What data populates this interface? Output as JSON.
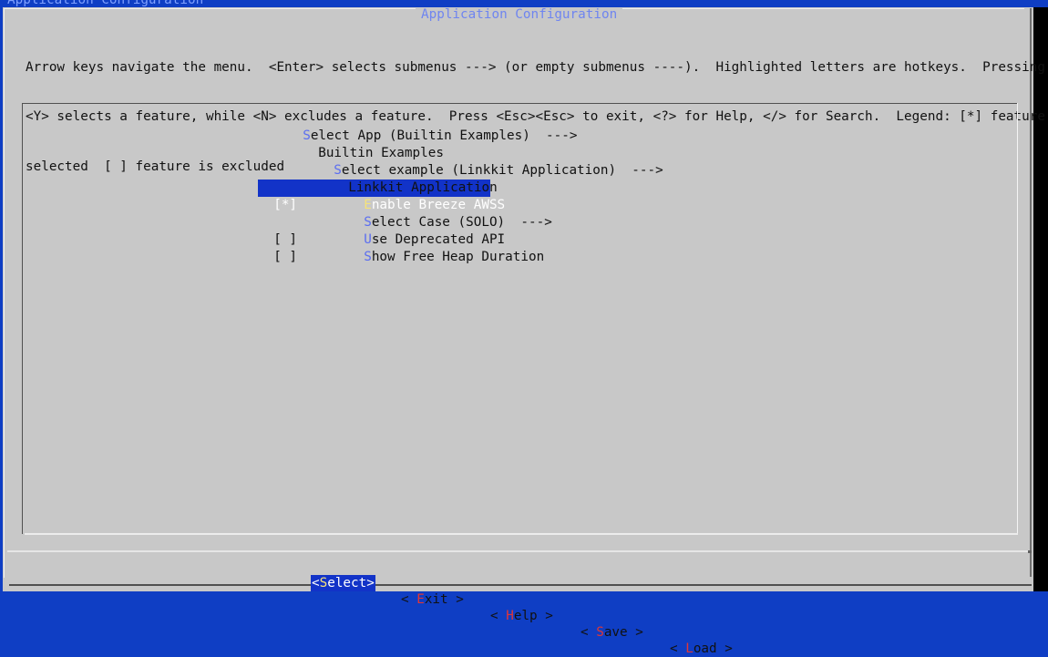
{
  "window": {
    "topbar_title": "Application Configuration"
  },
  "dialog": {
    "title": "Application Configuration",
    "help_lines": [
      "Arrow keys navigate the menu.  <Enter> selects submenus ---> (or empty submenus ----).  Highlighted letters are hotkeys.  Pressing",
      "<Y> selects a feature, while <N> excludes a feature.  Press <Esc><Esc> to exit, <?> for Help, </> for Search.  Legend: [*] feature is",
      "selected  [ ] feature is excluded"
    ]
  },
  "menu": {
    "items": [
      {
        "checkbox": "",
        "hotkey": "S",
        "rest": "elect App (Builtin Examples)  --->",
        "selected": false
      },
      {
        "checkbox": "",
        "hotkey": "",
        "rest": "Builtin Examples",
        "selected": false
      },
      {
        "checkbox": "",
        "hotkey": "S",
        "rest": "elect example (Linkkit Application)  --->",
        "selected": false
      },
      {
        "checkbox": "",
        "hotkey": "",
        "rest": "Linkkit Application",
        "selected": false
      },
      {
        "checkbox": "[*]",
        "hotkey": "E",
        "rest": "nable Breeze AWSS",
        "selected": true
      },
      {
        "checkbox": "",
        "hotkey": "S",
        "rest": "elect Case (SOLO)  --->",
        "selected": false
      },
      {
        "checkbox": "[ ]",
        "hotkey": "U",
        "rest": "se Deprecated API",
        "selected": false
      },
      {
        "checkbox": "[ ]",
        "hotkey": "S",
        "rest": "how Free Heap Duration",
        "selected": false
      }
    ]
  },
  "buttons": [
    {
      "pre": "<",
      "hotkey": "S",
      "post": "elect>",
      "active": true
    },
    {
      "pre": "< ",
      "hotkey": "E",
      "post": "xit >",
      "active": false
    },
    {
      "pre": "< ",
      "hotkey": "H",
      "post": "elp >",
      "active": false
    },
    {
      "pre": "< ",
      "hotkey": "S",
      "post": "ave >",
      "active": false
    },
    {
      "pre": "< ",
      "hotkey": "L",
      "post": "oad >",
      "active": false
    }
  ],
  "colors": {
    "background_blue": "#0f3ec4",
    "dialog_gray": "#c8c8c8",
    "highlight_blue": "#1233c8",
    "hotkey_blue": "#5b6ef0",
    "hotkey_red": "#e13636",
    "hotkey_yellow": "#f5e27a"
  }
}
